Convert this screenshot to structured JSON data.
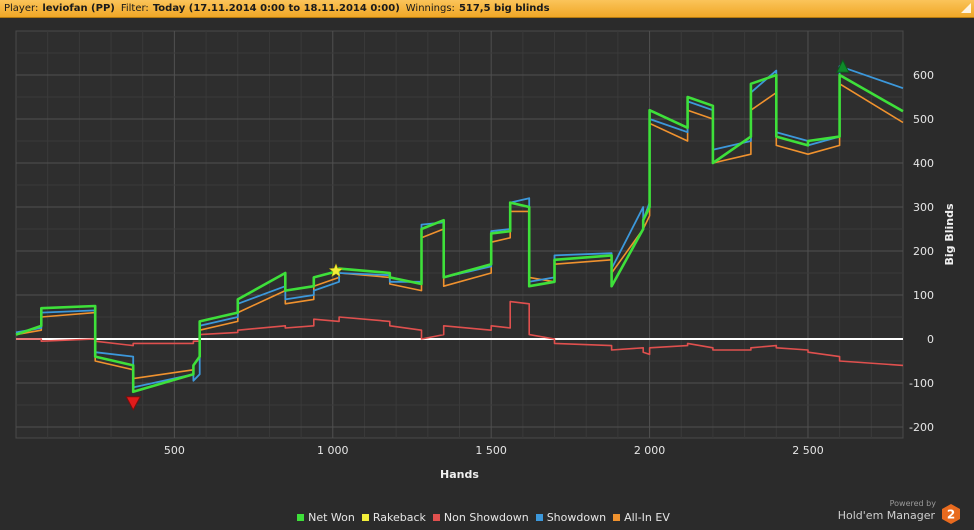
{
  "header": {
    "player_label": "Player:",
    "player_value": "leviofan (PP)",
    "filter_label": "Filter:",
    "filter_value": "Today (17.11.2014 0:00 to 18.11.2014 0:00)",
    "winnings_label": "Winnings:",
    "winnings_value": "517,5 big blinds"
  },
  "branding": {
    "powered_by": "Powered by",
    "product": "Hold'em Manager",
    "badge": "2"
  },
  "colors": {
    "net_won": "#3ee03a",
    "rakeback": "#f2ee3a",
    "non_showdown": "#e0504e",
    "showdown": "#3c98db",
    "all_in_ev": "#f0922e",
    "header_bg": "#f5b23c"
  },
  "chart_data": {
    "type": "line",
    "xlabel": "Hands",
    "ylabel": "Big Blinds",
    "xlim": [
      0,
      2800
    ],
    "ylim": [
      -225,
      700
    ],
    "x_ticks": [
      500,
      1000,
      1500,
      2000,
      2500
    ],
    "x_tick_labels": [
      "500",
      "1 000",
      "1 500",
      "2 000",
      "2 500"
    ],
    "y_ticks": [
      -200,
      -100,
      0,
      100,
      200,
      300,
      400,
      500,
      600
    ],
    "y_tick_labels": [
      "-200",
      "-100",
      "0",
      "100",
      "200",
      "300",
      "400",
      "500",
      "600"
    ],
    "grid": true,
    "legend_position": "bottom",
    "x": [
      0,
      80,
      80,
      250,
      250,
      370,
      370,
      560,
      560,
      580,
      580,
      700,
      700,
      850,
      850,
      940,
      940,
      1020,
      1020,
      1180,
      1180,
      1280,
      1280,
      1350,
      1350,
      1500,
      1500,
      1560,
      1560,
      1620,
      1620,
      1700,
      1700,
      1880,
      1880,
      1980,
      1980,
      2000,
      2000,
      2120,
      2120,
      2200,
      2200,
      2320,
      2320,
      2400,
      2400,
      2500,
      2500,
      2600,
      2600,
      2800
    ],
    "series": [
      {
        "name": "Net Won",
        "values": [
          10,
          30,
          70,
          75,
          -40,
          -60,
          -120,
          -80,
          -60,
          -40,
          40,
          60,
          90,
          150,
          110,
          120,
          140,
          155,
          160,
          150,
          140,
          125,
          250,
          270,
          140,
          170,
          240,
          245,
          310,
          300,
          120,
          130,
          180,
          190,
          120,
          250,
          270,
          300,
          520,
          480,
          550,
          530,
          400,
          460,
          580,
          600,
          460,
          440,
          450,
          460,
          600,
          517.5
        ]
      },
      {
        "name": "Showdown",
        "values": [
          15,
          25,
          60,
          65,
          -30,
          -40,
          -110,
          -80,
          -95,
          -80,
          30,
          50,
          80,
          120,
          90,
          100,
          110,
          130,
          150,
          145,
          130,
          130,
          260,
          265,
          140,
          165,
          245,
          250,
          310,
          320,
          130,
          140,
          190,
          195,
          160,
          300,
          270,
          310,
          500,
          470,
          540,
          520,
          430,
          450,
          560,
          610,
          470,
          450,
          440,
          460,
          620,
          570
        ]
      },
      {
        "name": "All-In EV",
        "values": [
          10,
          20,
          50,
          60,
          -50,
          -70,
          -90,
          -70,
          -60,
          -40,
          20,
          40,
          60,
          110,
          80,
          90,
          120,
          140,
          150,
          140,
          125,
          110,
          230,
          250,
          120,
          150,
          220,
          230,
          290,
          290,
          140,
          130,
          170,
          180,
          150,
          250,
          250,
          280,
          490,
          450,
          520,
          500,
          400,
          420,
          520,
          560,
          440,
          420,
          420,
          440,
          580,
          492
        ]
      },
      {
        "name": "Non Showdown",
        "values": [
          0,
          0,
          -5,
          0,
          -5,
          -15,
          -10,
          -10,
          -5,
          -5,
          10,
          15,
          20,
          30,
          25,
          30,
          45,
          40,
          50,
          40,
          30,
          20,
          0,
          10,
          30,
          20,
          30,
          25,
          85,
          80,
          10,
          0,
          -10,
          -15,
          -25,
          -20,
          -30,
          -35,
          -20,
          -15,
          -10,
          -20,
          -25,
          -25,
          -20,
          -15,
          -20,
          -25,
          -30,
          -40,
          -50,
          -60
        ]
      },
      {
        "name": "Rakeback",
        "values": []
      }
    ],
    "annotations": [
      {
        "type": "max_marker",
        "x": 2610,
        "y": 620
      },
      {
        "type": "min_marker",
        "x": 370,
        "y": -145
      },
      {
        "type": "rakeback_star",
        "x": 1010,
        "y": 155
      }
    ]
  }
}
